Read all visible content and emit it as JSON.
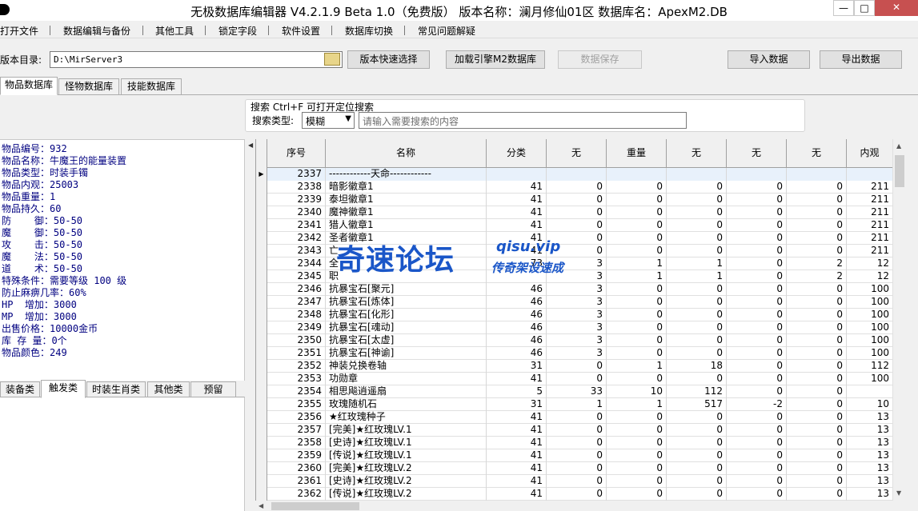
{
  "window": {
    "title": "无极数据库编辑器 V4.2.1.9   Beta 1.0（免费版）   版本名称：澜月修仙01区    数据库名：ApexM2.DB",
    "min_label": "—",
    "max_label": "□",
    "close_label": "✕"
  },
  "menu": [
    "打开文件",
    "数据编辑与备份",
    "其他工具",
    "锁定字段",
    "软件设置",
    "数据库切换",
    "常见问题解疑"
  ],
  "toolbar": {
    "path_label": "版本目录:",
    "path_value": "D:\\MirServer3",
    "quick_select": "版本快速选择",
    "load_engine": "加载引擎M2数据库",
    "save_data": "数据保存",
    "import_data": "导入数据",
    "export_data": "导出数据"
  },
  "tabs": [
    "物品数据库",
    "怪物数据库",
    "技能数据库"
  ],
  "search": {
    "hint": "搜索  Ctrl+F 可打开定位搜索",
    "type_label": "搜索类型:",
    "type_value": "模糊",
    "placeholder": "请输入需要搜索的内容"
  },
  "item_info": [
    "物品编号：932",
    "物品名称：牛魔王的能量装置",
    "物品类型：时装手镯",
    "物品内观：25003",
    "物品重量：1",
    "物品持久：60",
    "防    御：50-50",
    "魔    御：50-50",
    "攻    击：50-50",
    "魔    法：50-50",
    "道    术：50-50",
    "特殊条件：需要等级 100 级",
    "防止麻痹几率：60%",
    "HP  增加：3000",
    "MP  增加：3000",
    "出售价格：10000金币",
    "库 存 量：0个",
    "物品颜色：249"
  ],
  "sub_tabs": [
    "装备类",
    "触发类",
    "时装生肖类",
    "其他类",
    "预留"
  ],
  "grid": {
    "columns": [
      "序号",
      "名称",
      "分类",
      "无",
      "重量",
      "无",
      "无",
      "无",
      "内观"
    ],
    "rows": [
      [
        "2337",
        "------------天命------------",
        "",
        "",
        "",
        "",
        "",
        "",
        ""
      ],
      [
        "2338",
        "暗影徽章1",
        "41",
        "0",
        "0",
        "0",
        "0",
        "0",
        "211"
      ],
      [
        "2339",
        "泰坦徽章1",
        "41",
        "0",
        "0",
        "0",
        "0",
        "0",
        "211"
      ],
      [
        "2340",
        "魔神徽章1",
        "41",
        "0",
        "0",
        "0",
        "0",
        "0",
        "211"
      ],
      [
        "2341",
        "猎人徽章1",
        "41",
        "0",
        "0",
        "0",
        "0",
        "0",
        "211"
      ],
      [
        "2342",
        "圣者徽章1",
        "41",
        "0",
        "0",
        "0",
        "0",
        "0",
        "211"
      ],
      [
        "2343",
        "亡",
        "41",
        "0",
        "0",
        "0",
        "0",
        "0",
        "211"
      ],
      [
        "2344",
        "全",
        "73",
        "3",
        "1",
        "1",
        "0",
        "2",
        "12"
      ],
      [
        "2345",
        "职",
        "",
        "3",
        "1",
        "1",
        "0",
        "2",
        "12"
      ],
      [
        "2346",
        "抗暴宝石[聚元]",
        "46",
        "3",
        "0",
        "0",
        "0",
        "0",
        "100"
      ],
      [
        "2347",
        "抗暴宝石[炼体]",
        "46",
        "3",
        "0",
        "0",
        "0",
        "0",
        "100"
      ],
      [
        "2348",
        "抗暴宝石[化形]",
        "46",
        "3",
        "0",
        "0",
        "0",
        "0",
        "100"
      ],
      [
        "2349",
        "抗暴宝石[魂动]",
        "46",
        "3",
        "0",
        "0",
        "0",
        "0",
        "100"
      ],
      [
        "2350",
        "抗暴宝石[太虚]",
        "46",
        "3",
        "0",
        "0",
        "0",
        "0",
        "100"
      ],
      [
        "2351",
        "抗暴宝石[神谕]",
        "46",
        "3",
        "0",
        "0",
        "0",
        "0",
        "100"
      ],
      [
        "2352",
        "神装兑换卷轴",
        "31",
        "0",
        "1",
        "18",
        "0",
        "0",
        "112"
      ],
      [
        "2353",
        "功勋章",
        "41",
        "0",
        "0",
        "0",
        "0",
        "0",
        "100"
      ],
      [
        "2354",
        "相思飚逍遥扇",
        "5",
        "33",
        "10",
        "112",
        "0",
        "0",
        ""
      ],
      [
        "2355",
        "玫瑰随机石",
        "31",
        "1",
        "1",
        "517",
        "-2",
        "0",
        "10"
      ],
      [
        "2356",
        "★红玫瑰种子",
        "41",
        "0",
        "0",
        "0",
        "0",
        "0",
        "13"
      ],
      [
        "2357",
        "[完美]★红玫瑰LV.1",
        "41",
        "0",
        "0",
        "0",
        "0",
        "0",
        "13"
      ],
      [
        "2358",
        "[史诗]★红玫瑰LV.1",
        "41",
        "0",
        "0",
        "0",
        "0",
        "0",
        "13"
      ],
      [
        "2359",
        "[传说]★红玫瑰LV.1",
        "41",
        "0",
        "0",
        "0",
        "0",
        "0",
        "13"
      ],
      [
        "2360",
        "[完美]★红玫瑰LV.2",
        "41",
        "0",
        "0",
        "0",
        "0",
        "0",
        "13"
      ],
      [
        "2361",
        "[史诗]★红玫瑰LV.2",
        "41",
        "0",
        "0",
        "0",
        "0",
        "0",
        "13"
      ],
      [
        "2362",
        "[传说]★红玫瑰LV.2",
        "41",
        "0",
        "0",
        "0",
        "0",
        "0",
        "13"
      ]
    ]
  },
  "watermark": {
    "main": "奇速论坛",
    "domain": "qisu.vip",
    "slogan": "传奇架设速成"
  }
}
